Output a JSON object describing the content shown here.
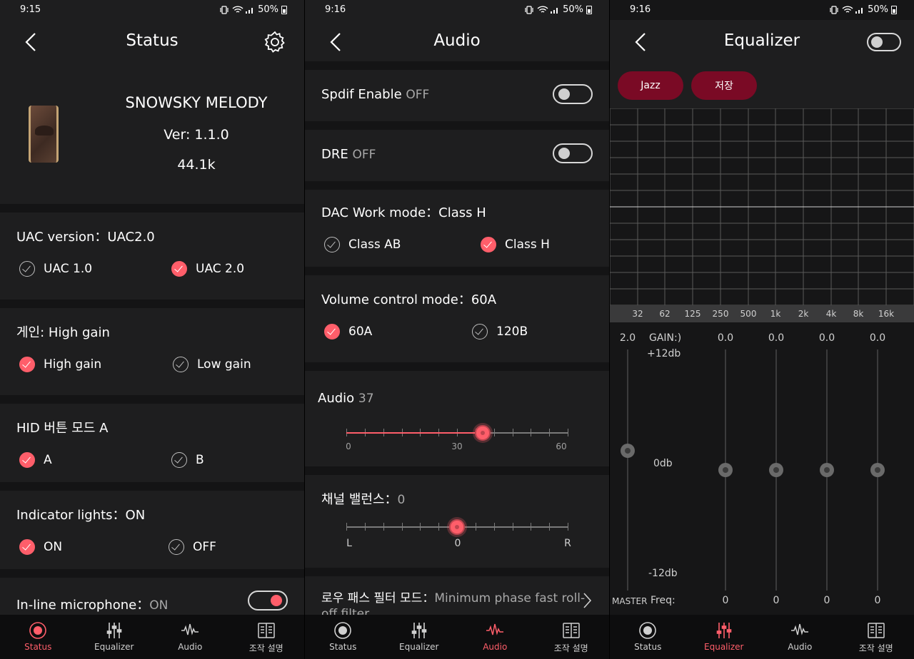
{
  "status_panel": {
    "statusbar": {
      "time": "9:15",
      "battery": "50%"
    },
    "title": "Status",
    "device": {
      "name": "SNOWSKY MELODY",
      "version": "Ver: 1.1.0",
      "rate": "44.1k"
    },
    "uac": {
      "title": "UAC version：UAC2.0",
      "options": [
        "UAC 1.0",
        "UAC 2.0"
      ],
      "selected": 1
    },
    "gain": {
      "title": "게인:  High gain",
      "options": [
        "High gain",
        "Low gain"
      ],
      "selected": 0
    },
    "hid": {
      "title": "HID 버튼 모드 A",
      "options": [
        "A",
        "B"
      ],
      "selected": 0
    },
    "indicator": {
      "title": "Indicator lights：ON",
      "options": [
        "ON",
        "OFF"
      ],
      "selected": 0
    },
    "mic": {
      "label": "In-line microphone：",
      "value": "ON",
      "enabled": true
    }
  },
  "audio_panel": {
    "statusbar": {
      "time": "9:16",
      "battery": "50%"
    },
    "title": "Audio",
    "spdif": {
      "label": "Spdif Enable ",
      "value": "OFF",
      "enabled": false
    },
    "dre": {
      "label": "DRE ",
      "value": "OFF",
      "enabled": false
    },
    "dac": {
      "title": "DAC Work mode：Class H",
      "options": [
        "Class AB",
        "Class H"
      ],
      "selected": 1
    },
    "volume": {
      "title": "Volume control mode：60A",
      "options": [
        "60A",
        "120B"
      ],
      "selected": 0
    },
    "audio_level": {
      "label": "Audio ",
      "value": "37",
      "min_label": "0",
      "mid_label": "30",
      "max_label": "60",
      "min": 0,
      "max": 60,
      "current": 37
    },
    "balance": {
      "label": "채널 밸런스：",
      "value": "0",
      "min_label": "L",
      "mid_label": "0",
      "max_label": "R",
      "position": 0.5
    },
    "lpf": {
      "label": "로우 패스 필터 모드：",
      "value": "Minimum phase fast roll-off filter"
    }
  },
  "eq_panel": {
    "statusbar": {
      "time": "9:16",
      "battery": "50%"
    },
    "title": "Equalizer",
    "enabled": false,
    "presets": [
      "Jazz",
      "저장"
    ],
    "frequencies": [
      "32",
      "62",
      "125",
      "250",
      "500",
      "1k",
      "2k",
      "4k",
      "8k",
      "16k"
    ],
    "master": {
      "value": "2.0",
      "label": "MASTER",
      "level": 0.42
    },
    "gain_label": "GAIN:)",
    "plus": "+12db",
    "zero": "0db",
    "minus": "-12db",
    "freq_label": "Freq:",
    "bands": [
      {
        "value": "0.0",
        "freq": "0",
        "level": 0.5
      },
      {
        "value": "0.0",
        "freq": "0",
        "level": 0.5
      },
      {
        "value": "0.0",
        "freq": "0",
        "level": 0.5
      },
      {
        "value": "0.0",
        "freq": "0",
        "level": 0.5
      }
    ]
  },
  "nav": {
    "status": "Status",
    "equalizer": "Equalizer",
    "audio": "Audio",
    "manual": "조작 설명"
  },
  "colors": {
    "accent": "#ff5e6a",
    "preset": "#7a0a25",
    "background": "#1e1e1f"
  }
}
